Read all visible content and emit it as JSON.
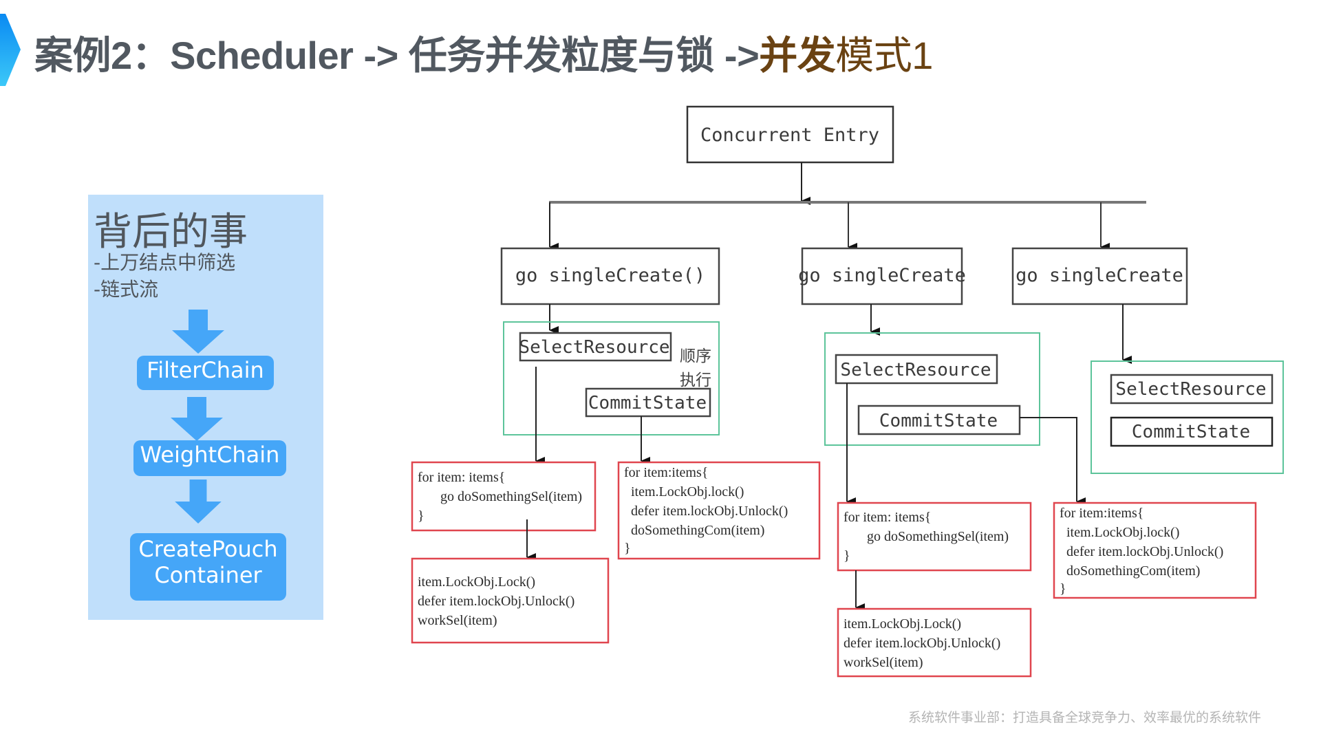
{
  "title": {
    "prefix": "案例2：Scheduler -> 任务并发粒度与锁 ->",
    "highlight_bold": "并发",
    "highlight_rest": "模式1",
    "accent_colors": [
      "#0a8af2",
      "#3cc8f8"
    ],
    "highlight_color": "#6a4212"
  },
  "side_panel": {
    "heading": "背后的事",
    "bullets": [
      "-上万结点中筛选",
      "-链式流"
    ],
    "chain": [
      {
        "label": "FilterChain"
      },
      {
        "label": "WeightChain"
      },
      {
        "label_line1": "CreatePouch",
        "label_line2": "Container"
      }
    ],
    "colors": {
      "panel_bg": "#c0dffb",
      "box_bg": "#45a6f8"
    }
  },
  "diagram": {
    "entry": "Concurrent Entry",
    "workers": [
      {
        "label": "go singleCreate()"
      },
      {
        "label": "go singleCreate"
      },
      {
        "label": "go singleCreate"
      }
    ],
    "stages": {
      "select": "SelectResource",
      "commit": "CommitState",
      "sequential_note_line1": "顺序",
      "sequential_note_line2": "执行"
    },
    "code_blocks": {
      "select_loop": [
        "for item: items{",
        "  go doSomethingSel(item)",
        "}"
      ],
      "select_work": [
        "item.LockObj.Lock()",
        "defer item.lockObj.Unlock()",
        "workSel(item)"
      ],
      "commit_loop": [
        "for item:items{",
        " item.LockObj.lock()",
        " defer item.lockObj.Unlock()",
        " doSomethingCom(item)",
        "}"
      ]
    },
    "colors": {
      "group_border": "#5cc49a",
      "code_border": "#e0454e",
      "box_border": "#404040"
    }
  },
  "footer": "系统软件事业部：打造具备全球竞争力、效率最优的系统软件"
}
